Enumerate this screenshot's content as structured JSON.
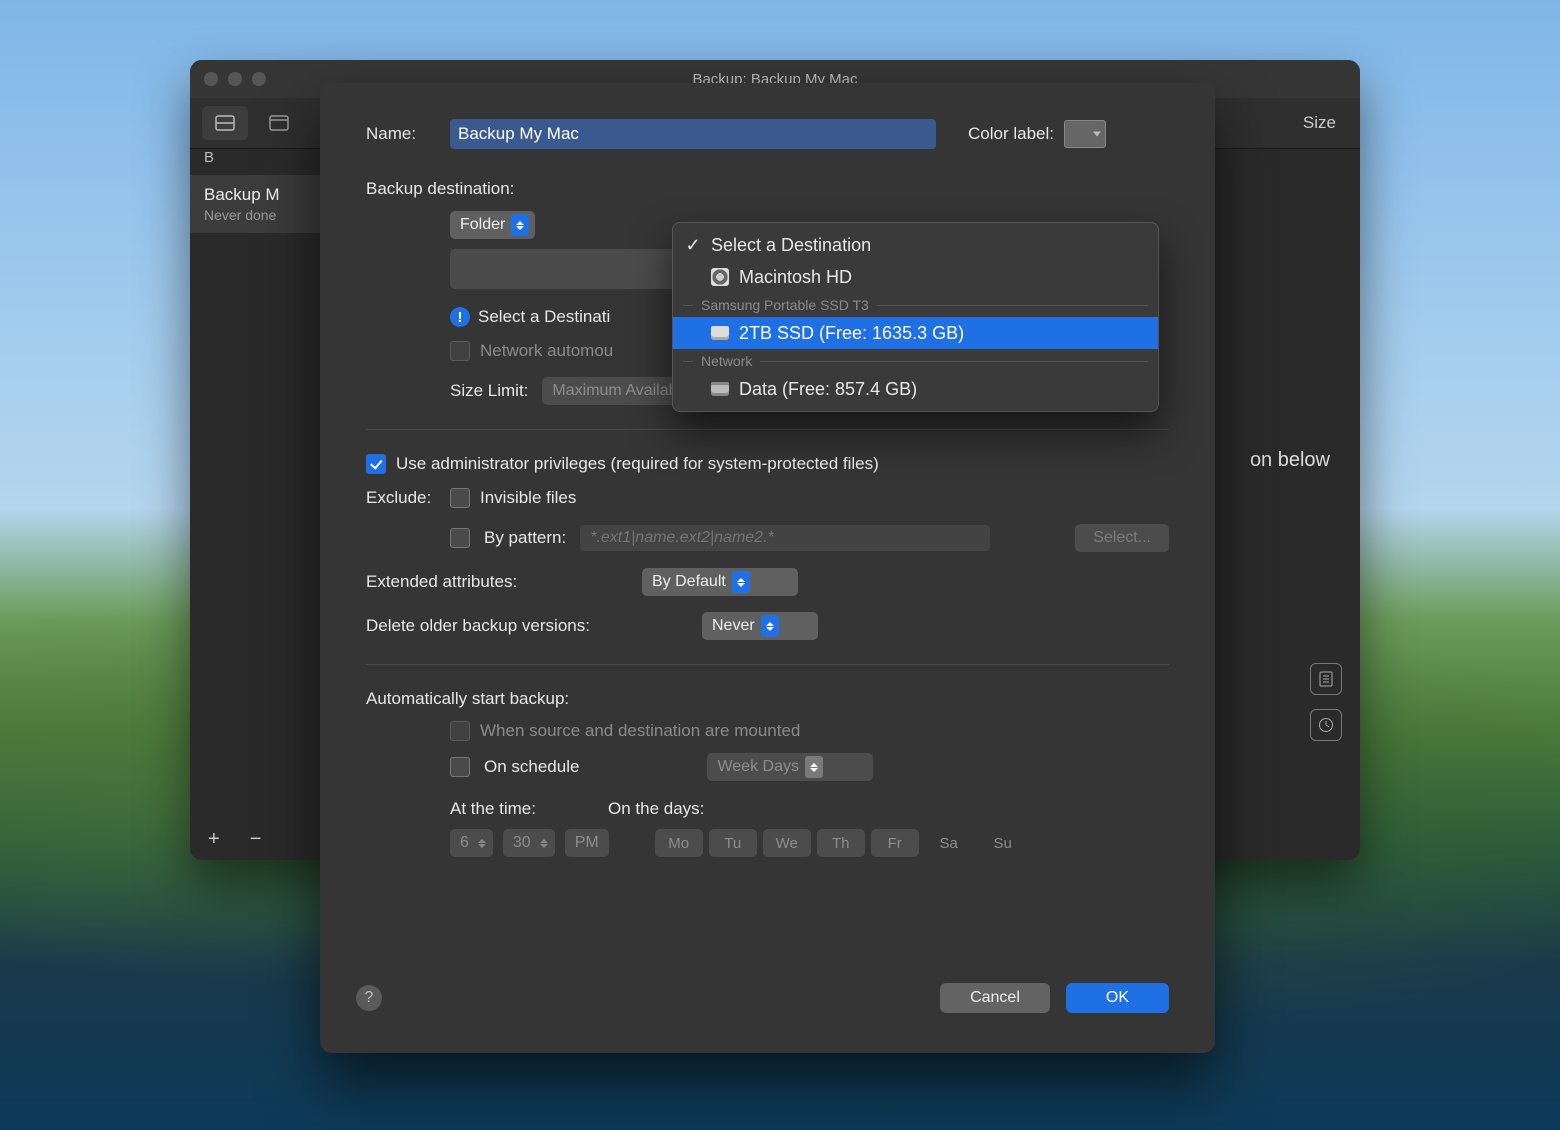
{
  "root_window": {
    "title": "Backup: Backup My Mac",
    "toolbar_size": "Size",
    "sidebar_header": "B",
    "sidebar_item_title": "Backup M",
    "sidebar_item_sub": "Never done",
    "main_hint_text": "on below",
    "add_sym": "+",
    "remove_sym": "−"
  },
  "sheet": {
    "name_label": "Name:",
    "name_value": "Backup My Mac",
    "color_label": "Color label:",
    "dest_label": "Backup destination:",
    "folder_select": "Folder",
    "warn_text": "Select a Destinati",
    "net_automount": "Network automou",
    "size_limit_label": "Size Limit:",
    "size_limit_value": "Maximum Available...",
    "admin_priv": "Use administrator privileges (required for system-protected files)",
    "exclude_label": "Exclude:",
    "exclude_invisible": "Invisible files",
    "exclude_pattern_label": "By pattern:",
    "exclude_pattern_placeholder": "*.ext1|name.ext2|name2.*",
    "select_btn": "Select...",
    "ext_attr_label": "Extended attributes:",
    "ext_attr_value": "By Default",
    "del_older_label": "Delete older backup versions:",
    "del_older_value": "Never",
    "auto_start_label": "Automatically start backup:",
    "auto_when_mounted": "When source and destination are mounted",
    "auto_on_schedule": "On schedule",
    "auto_schedule_value": "Week Days",
    "at_time_label": "At the time:",
    "on_days_label": "On the days:",
    "time_h": "6",
    "time_m": "30",
    "time_ampm": "PM",
    "days": [
      "Mo",
      "Tu",
      "We",
      "Th",
      "Fr",
      "Sa",
      "Su"
    ],
    "help_sym": "?",
    "cancel": "Cancel",
    "ok": "OK"
  },
  "popup": {
    "header": "Select a Destination",
    "mac_hd": "Macintosh HD",
    "grp1": "Samsung Portable SSD T3",
    "ssd": "2TB SSD (Free: 1635.3 GB)",
    "grp2": "Network",
    "data": "Data (Free: 857.4 GB)",
    "check": "✓"
  }
}
